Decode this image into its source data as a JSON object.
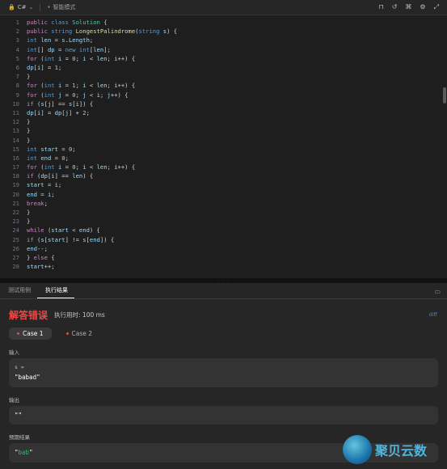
{
  "topbar": {
    "language": "C#",
    "mode": "智能模式"
  },
  "code_lines": [
    {
      "n": "1",
      "html": "<span class=\"k\">public</span> <span class=\"t\">class</span> <span class=\"c\">Solution</span> {"
    },
    {
      "n": "2",
      "html": "<span class=\"k\">public</span> <span class=\"t\">string</span> <span class=\"f\">LongestPalindrome</span>(<span class=\"t\">string</span> <span class=\"v\">s</span>) {"
    },
    {
      "n": "3",
      "html": "<span class=\"t\">int</span> <span class=\"v\">len</span> = <span class=\"v\">s</span>.<span class=\"v\">Length</span>;"
    },
    {
      "n": "4",
      "html": "<span class=\"t\">int</span>[] <span class=\"v\">dp</span> = <span class=\"t\">new</span> <span class=\"t\">int</span>[<span class=\"v\">len</span>];"
    },
    {
      "n": "5",
      "html": "<span class=\"k\">for</span> (<span class=\"t\">int</span> <span class=\"v\">i</span> = <span class=\"n\">0</span>; <span class=\"v\">i</span> &lt; <span class=\"v\">len</span>; <span class=\"v\">i</span>++) {"
    },
    {
      "n": "6",
      "html": "<span class=\"v\">dp</span>[<span class=\"v\">i</span>] = <span class=\"n\">1</span>;"
    },
    {
      "n": "7",
      "html": "}"
    },
    {
      "n": "8",
      "html": "<span class=\"k\">for</span> (<span class=\"t\">int</span> <span class=\"v\">i</span> = <span class=\"n\">1</span>; <span class=\"v\">i</span> &lt; <span class=\"v\">len</span>; <span class=\"v\">i</span>++) {"
    },
    {
      "n": "9",
      "html": "<span class=\"k\">for</span> (<span class=\"t\">int</span> <span class=\"v\">j</span> = <span class=\"n\">0</span>; <span class=\"v\">j</span> &lt; <span class=\"v\">i</span>; <span class=\"v\">j</span>++) {"
    },
    {
      "n": "10",
      "html": "<span class=\"k\">if</span> (<span class=\"v\">s</span>[<span class=\"v\">j</span>] == <span class=\"v\">s</span>[<span class=\"v\">i</span>]) {"
    },
    {
      "n": "11",
      "html": "<span class=\"v\">dp</span>[<span class=\"v\">i</span>] = <span class=\"v\">dp</span>[<span class=\"v\">j</span>] + <span class=\"n\">2</span>;"
    },
    {
      "n": "12",
      "html": "}"
    },
    {
      "n": "13",
      "html": "}"
    },
    {
      "n": "14",
      "html": "}"
    },
    {
      "n": "15",
      "html": "<span class=\"t\">int</span> <span class=\"v\">start</span> = <span class=\"n\">0</span>;"
    },
    {
      "n": "16",
      "html": "<span class=\"t\">int</span> <span class=\"v\">end</span> = <span class=\"n\">0</span>;"
    },
    {
      "n": "17",
      "html": "<span class=\"k\">for</span> (<span class=\"t\">int</span> <span class=\"v\">i</span> = <span class=\"n\">0</span>; <span class=\"v\">i</span> &lt; <span class=\"v\">len</span>; <span class=\"v\">i</span>++) {"
    },
    {
      "n": "18",
      "html": "<span class=\"k\">if</span> (<span class=\"v\">dp</span>[<span class=\"v\">i</span>] == <span class=\"v\">len</span>) {"
    },
    {
      "n": "19",
      "html": "<span class=\"v\">start</span> = <span class=\"v\">i</span>;"
    },
    {
      "n": "20",
      "html": "<span class=\"v\">end</span> = <span class=\"v\">i</span>;"
    },
    {
      "n": "21",
      "html": "<span class=\"k\">break</span>;"
    },
    {
      "n": "22",
      "html": "}"
    },
    {
      "n": "23",
      "html": "}"
    },
    {
      "n": "24",
      "html": "<span class=\"k\">while</span> (<span class=\"v\">start</span> &lt; <span class=\"v\">end</span>) {"
    },
    {
      "n": "25",
      "html": "<span class=\"k\">if</span> (<span class=\"v\">s</span>[<span class=\"v\">start</span>] != <span class=\"v\">s</span>[<span class=\"v\">end</span>]) {"
    },
    {
      "n": "26",
      "html": "<span class=\"v\">end</span>--;"
    },
    {
      "n": "27",
      "html": "} <span class=\"k\">else</span> {"
    },
    {
      "n": "28",
      "html": "<span class=\"v\">start</span>++;"
    }
  ],
  "panel": {
    "tabs": [
      "测试用例",
      "执行结果"
    ],
    "result_title": "解答错误",
    "runtime": "执行用时: 100 ms",
    "diff_link": "diff",
    "cases": [
      "Case 1",
      "Case 2"
    ],
    "input_label": "输入",
    "input_var": "s =",
    "input_value": "\"babad\"",
    "output_label": "输出",
    "output_value": "\"\"",
    "expected_label": "预期结果",
    "expected_value_q1": "\"",
    "expected_value_core": "bab",
    "expected_value_q2": "\""
  },
  "watermark": {
    "text": "聚贝云数"
  }
}
